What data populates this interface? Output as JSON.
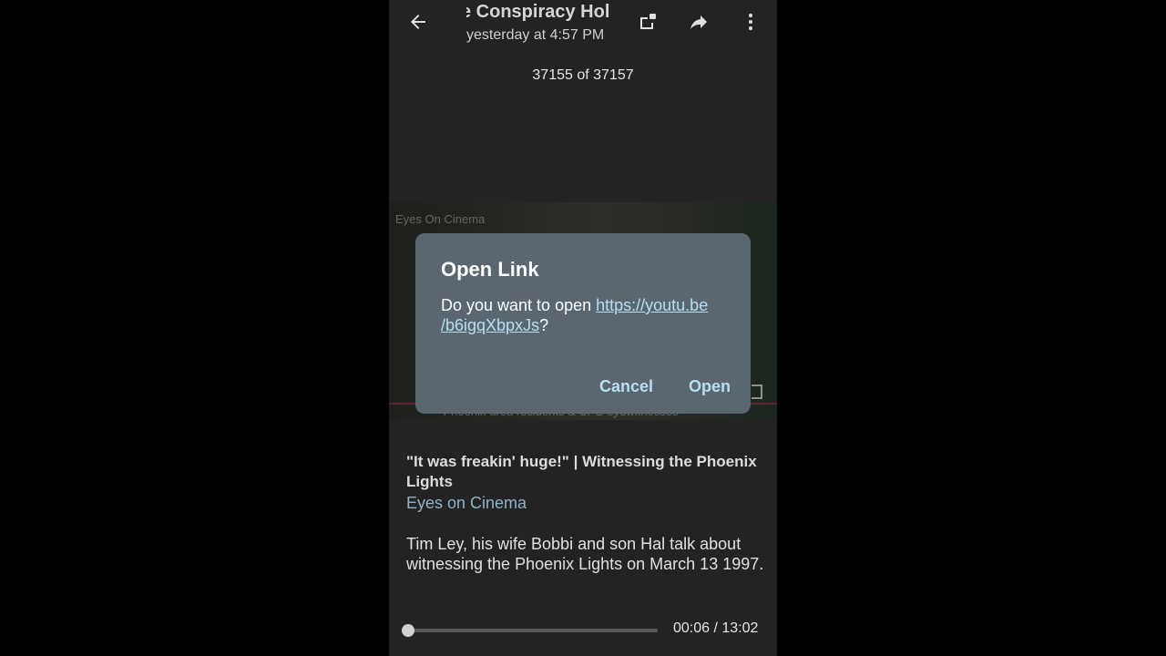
{
  "header": {
    "title": "e Conspiracy Hol",
    "subtitle": "yesterday at 4:57 PM",
    "counter": "37155 of 37157",
    "icons": [
      "back-arrow-icon",
      "popout-icon",
      "share-icon",
      "more-vert-icon"
    ]
  },
  "video": {
    "watermark": "Eyes On Cinema",
    "caption": "Phoenix area residents & UFO eyewitnesses"
  },
  "dialog": {
    "title": "Open Link",
    "body_prefix": "Do you want to open ",
    "link_line1": "https://youtu.be",
    "link_line2": "/b6igqXbpxJs",
    "body_suffix": "?",
    "cancel_label": "Cancel",
    "open_label": "Open"
  },
  "info": {
    "title": "\"It was freakin' huge!\" | Witnessing the Phoenix Lights",
    "channel": "Eyes on Cinema",
    "description": "Tim Ley, his wife Bobbi and son Hal talk about witnessing the Phoenix Lights on March 13 1997."
  },
  "player": {
    "time": "00:06 / 13:02",
    "progress_fraction": 0.008
  },
  "colors": {
    "accent_link": "#b6dff0",
    "dialog_bg": "#5b6770",
    "background": "#232323"
  }
}
